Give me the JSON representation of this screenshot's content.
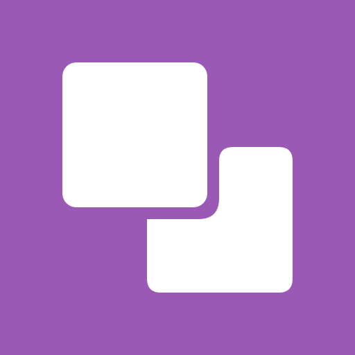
{
  "icon": {
    "name": "overlapping-squares-icon",
    "background_color": "#9B59B6",
    "foreground_color": "#FFFFFF"
  }
}
